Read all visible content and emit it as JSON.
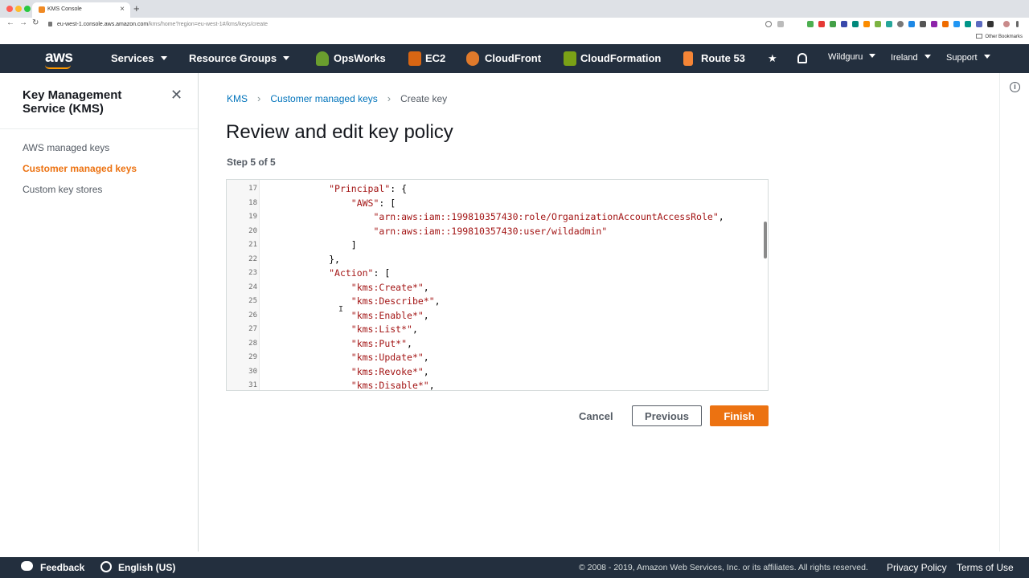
{
  "browser": {
    "tab_title": "KMS Console",
    "tab_close": "×",
    "new_tab": "+",
    "url_host": "eu-west-1.console.aws.amazon.com",
    "url_path": "/kms/home?region=eu-west-1#/kms/keys/create",
    "bookmarks_label": "Other Bookmarks",
    "nav_back": "←",
    "nav_forward": "→",
    "nav_reload": "↻"
  },
  "nav": {
    "logo": "aws",
    "services": "Services",
    "resource_groups": "Resource Groups",
    "shortcuts": [
      "OpsWorks",
      "EC2",
      "CloudFront",
      "CloudFormation",
      "Route 53"
    ],
    "account": "Wildguru",
    "region": "Ireland",
    "support": "Support"
  },
  "sidebar": {
    "title": "Key Management Service (KMS)",
    "close": "✕",
    "items": [
      {
        "label": "AWS managed keys",
        "active": false
      },
      {
        "label": "Customer managed keys",
        "active": true
      },
      {
        "label": "Custom key stores",
        "active": false
      }
    ]
  },
  "breadcrumb": {
    "items": [
      "KMS",
      "Customer managed keys",
      "Create key"
    ],
    "separator": "›"
  },
  "page": {
    "title": "Review and edit key policy",
    "step": "Step 5 of 5"
  },
  "editor": {
    "lines": [
      {
        "n": "17",
        "text": "            \"Principal\": {"
      },
      {
        "n": "18",
        "text": "                \"AWS\": ["
      },
      {
        "n": "19",
        "text": "                    \"arn:aws:iam::199810357430:role/OrganizationAccountAccessRole\","
      },
      {
        "n": "20",
        "text": "                    \"arn:aws:iam::199810357430:user/wildadmin\""
      },
      {
        "n": "21",
        "text": "                ]"
      },
      {
        "n": "22",
        "text": "            },"
      },
      {
        "n": "23",
        "text": "            \"Action\": ["
      },
      {
        "n": "24",
        "text": "                \"kms:Create*\","
      },
      {
        "n": "25",
        "text": "                \"kms:Describe*\","
      },
      {
        "n": "26",
        "text": "                \"kms:Enable*\","
      },
      {
        "n": "27",
        "text": "                \"kms:List*\","
      },
      {
        "n": "28",
        "text": "                \"kms:Put*\","
      },
      {
        "n": "29",
        "text": "                \"kms:Update*\","
      },
      {
        "n": "30",
        "text": "                \"kms:Revoke*\","
      },
      {
        "n": "31",
        "text": "                \"kms:Disable*\","
      }
    ]
  },
  "actions": {
    "cancel": "Cancel",
    "previous": "Previous",
    "finish": "Finish"
  },
  "footer": {
    "feedback": "Feedback",
    "language": "English (US)",
    "copyright": "© 2008 - 2019, Amazon Web Services, Inc. or its affiliates. All rights reserved.",
    "privacy": "Privacy Policy",
    "terms": "Terms of Use"
  },
  "colors": {
    "nav_bg": "#232f3e",
    "accent": "#ec7211",
    "link": "#0073bb",
    "code_string": "#a31515"
  }
}
